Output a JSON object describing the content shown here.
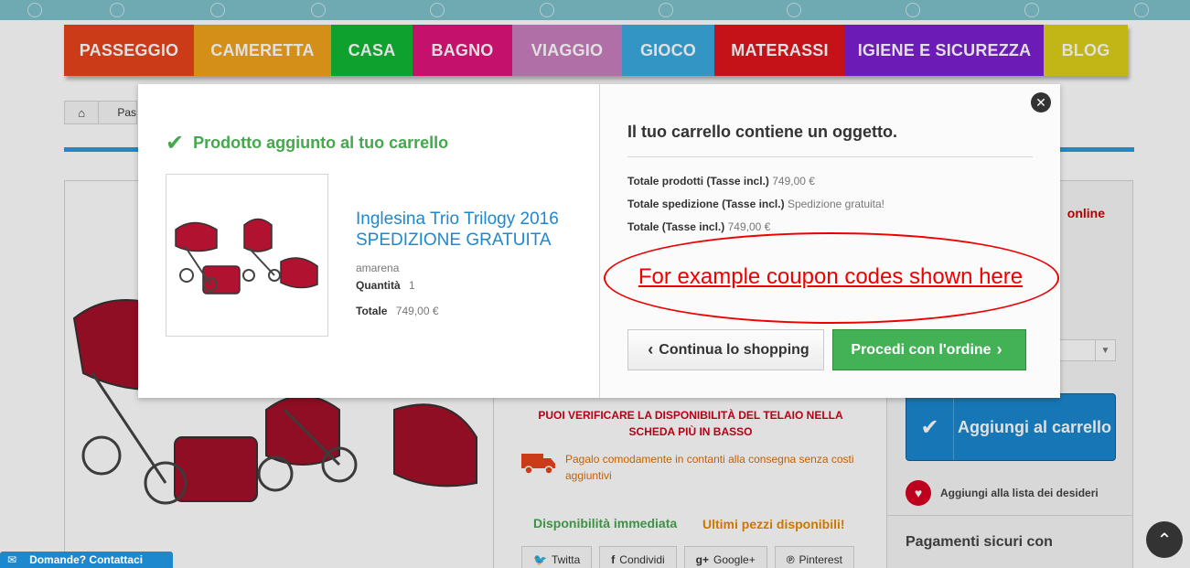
{
  "nav": {
    "items": [
      {
        "label": "PASSEGGIO",
        "color": "#e8441c",
        "width": 142
      },
      {
        "label": "CAMERETTA",
        "color": "#f2a31d",
        "width": 150
      },
      {
        "label": "CASA",
        "color": "#11b834",
        "width": 89
      },
      {
        "label": "BAGNO",
        "color": "#e0157b",
        "width": 109
      },
      {
        "label": "VIAGGIO",
        "color": "#c97fbd",
        "width": 120
      },
      {
        "label": "GIOCO",
        "color": "#39aadf",
        "width": 101
      },
      {
        "label": "MATERASSI",
        "color": "#e0151c",
        "width": 143
      },
      {
        "label": "IGIENE E SICUREZZA",
        "color": "#7b1fd1",
        "width": 217
      },
      {
        "label": "BLOG",
        "color": "#dcd019",
        "width": 92
      }
    ]
  },
  "breadcrumb": {
    "home_icon": "home-icon",
    "first": "Pas"
  },
  "product_page": {
    "online_text": "online",
    "red_note": "PUOI VERIFICARE LA DISPONIBILITÀ DEL TELAIO NELLA SCHEDA PIÙ IN BASSO",
    "cod_note": "Pagalo comodamente in contanti alla consegna senza costi aggiuntivi",
    "availability": "Disponibilità immediata",
    "last_items": "Ultimi pezzi disponibili!",
    "social": [
      {
        "icon": "twitter-icon",
        "glyph": "🐦",
        "label": "Twitta"
      },
      {
        "icon": "facebook-icon",
        "glyph": "f",
        "label": "Condividi"
      },
      {
        "icon": "googleplus-icon",
        "glyph": "g+",
        "label": "Google+"
      },
      {
        "icon": "pinterest-icon",
        "glyph": "℗",
        "label": "Pinterest"
      }
    ],
    "add_to_cart": "Aggiungi al carrello",
    "wishlist": "Aggiungi alla lista dei desideri",
    "secure_payments": "Pagamenti sicuri con"
  },
  "modal": {
    "added_title": "Prodotto aggiunto al tuo carrello",
    "product": {
      "name": "Inglesina Trio Trilogy 2016 SPEDIZIONE GRATUITA",
      "attribute": "amarena",
      "quantity_label": "Quantità",
      "quantity": "1",
      "total_label": "Totale",
      "total": "749,00 €"
    },
    "cart_title": "Il tuo carrello contiene un oggetto.",
    "summary": {
      "products_label": "Totale prodotti (Tasse incl.)",
      "products_value": "749,00 €",
      "shipping_label": "Totale spedizione (Tasse incl.)",
      "shipping_value": "Spedizione gratuita!",
      "total_label": "Totale (Tasse incl.)",
      "total_value": "749,00 €"
    },
    "annotation": "For example coupon codes shown here",
    "continue_label": "Continua lo shopping",
    "order_label": "Procedi con l'ordine"
  },
  "contact_tab": "Domande? Contattaci",
  "colors": {
    "accent_blue": "#1e88cf",
    "success_green": "#46a74e",
    "annotation_red": "#ee0000"
  }
}
